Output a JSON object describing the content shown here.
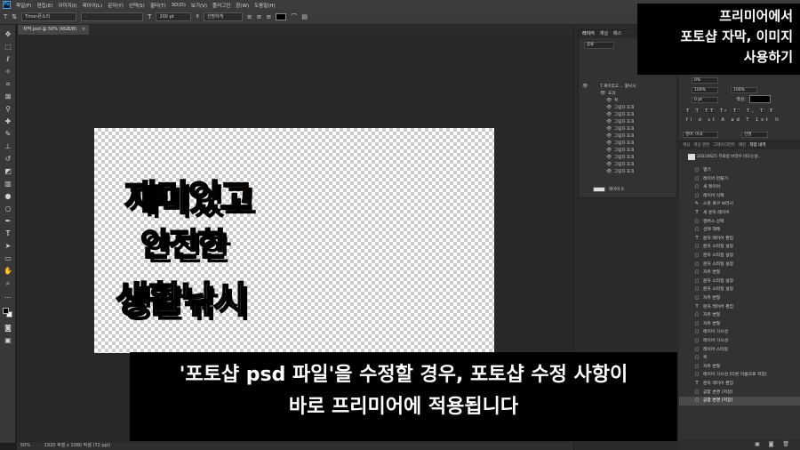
{
  "menu": {
    "logo": "Ps",
    "items": [
      "파일(F)",
      "편집(E)",
      "이미지(I)",
      "레이어(L)",
      "문자(Y)",
      "선택(S)",
      "필터(T)",
      "3D(D)",
      "보기(V)",
      "플러그인",
      "창(W)",
      "도움말(H)"
    ]
  },
  "options": {
    "tool_icon": "T",
    "font_family": "Tmon몬소리",
    "font_style": "-",
    "font_size_icon": "T",
    "font_size": "200 pt",
    "antialias": "선명하게",
    "text_color": "#000000"
  },
  "document": {
    "tab_label": "자막.psd @ 50% (RGB/8)",
    "close_glyph": "×",
    "headline_lines": [
      "재미있고",
      "안전한",
      "생활낚시"
    ],
    "headline_colors": [
      "#f0780a",
      "#3ccc14",
      "#ffffff"
    ]
  },
  "status": {
    "zoom": "50%",
    "doc_size": "1920 픽셀 x 1080 픽셀 (72 ppi)"
  },
  "layers_panel": {
    "tabs": [
      "레이어",
      "채널",
      "패스"
    ],
    "filter_label": "종류",
    "rows": [
      {
        "eye": "👁",
        "label": "T   재미있고 ... 활낚시"
      },
      {
        "eye": "👁",
        "label": "효과"
      },
      {
        "eye": "👁",
        "label": "획"
      },
      {
        "eye": "👁",
        "label": "그림자 효과"
      },
      {
        "eye": "👁",
        "label": "그림자 효과"
      },
      {
        "eye": "👁",
        "label": "그림자 효과"
      },
      {
        "eye": "👁",
        "label": "그림자 효과"
      },
      {
        "eye": "👁",
        "label": "그림자 효과"
      },
      {
        "eye": "👁",
        "label": "그림자 효과"
      },
      {
        "eye": "👁",
        "label": "그림자 효과"
      },
      {
        "eye": "👁",
        "label": "그림자 효과"
      },
      {
        "eye": "👁",
        "label": "그림자 효과"
      },
      {
        "eye": "👁",
        "label": "그림자 효과"
      },
      {
        "eye": "",
        "label": "레이어 0"
      }
    ]
  },
  "properties": {
    "size": "200 pt",
    "tracking": "0%",
    "horiz_scale": "100%",
    "vert_scale": "100%",
    "baseline": "0 pt",
    "color_label": "색상:",
    "language": "영어: 미국",
    "antialias": "선명"
  },
  "history_panel": {
    "tabs": [
      "색상",
      "색상 견본",
      "그레이디언트",
      "패턴",
      "작업 내역"
    ],
    "snapshot": "20210625 무료컴 브라우 비오는날...",
    "items": [
      {
        "icon": "▢",
        "label": "열기"
      },
      {
        "icon": "▢",
        "label": "레이어 만들기"
      },
      {
        "icon": "▢",
        "label": "새 레이어"
      },
      {
        "icon": "▢",
        "label": "레이어 삭제"
      },
      {
        "icon": "✎",
        "label": "스팟 복구 브러시"
      },
      {
        "icon": "T",
        "label": "새 문자 레이어"
      },
      {
        "icon": "▢",
        "label": "캔버스 선택"
      },
      {
        "icon": "▢",
        "label": "선택 해제"
      },
      {
        "icon": "T",
        "label": "문자 레이어 편집"
      },
      {
        "icon": "▢",
        "label": "문자 스타일 설정"
      },
      {
        "icon": "▢",
        "label": "문자 스타일 설정"
      },
      {
        "icon": "▢",
        "label": "문자 스타일 설정"
      },
      {
        "icon": "▢",
        "label": "자유 변형"
      },
      {
        "icon": "▢",
        "label": "문자 스타일 설정"
      },
      {
        "icon": "▢",
        "label": "문자 스타일 설정"
      },
      {
        "icon": "▢",
        "label": "자유 변형"
      },
      {
        "icon": "T",
        "label": "문자 레이어 편집"
      },
      {
        "icon": "▢",
        "label": "자유 변형"
      },
      {
        "icon": "▢",
        "label": "자유 변형"
      },
      {
        "icon": "▢",
        "label": "레이어 가시성"
      },
      {
        "icon": "▢",
        "label": "레이어 가시성"
      },
      {
        "icon": "▢",
        "label": "레이어 스타일"
      },
      {
        "icon": "▢",
        "label": "획"
      },
      {
        "icon": "▢",
        "label": "자유 변형"
      },
      {
        "icon": "▢",
        "label": "레이어 가시성 (다른 이름으로 저장)"
      },
      {
        "icon": "T",
        "label": "문자 레이어 편집"
      },
      {
        "icon": "▢",
        "label": "공합 변경 (저장)"
      },
      {
        "icon": "▢",
        "label": "공합 변경 (저장)"
      }
    ],
    "bottom_icons": "▣ ◙ 🗑"
  },
  "captions": {
    "top_lines": [
      "프리미어에서",
      "포토샵 자막, 이미지",
      "사용하기"
    ],
    "bottom_lines": [
      "'포토샵 psd 파일'을 수정할 경우, 포토샵 수정 사항이",
      "바로 프리미어에 적용됩니다"
    ]
  }
}
